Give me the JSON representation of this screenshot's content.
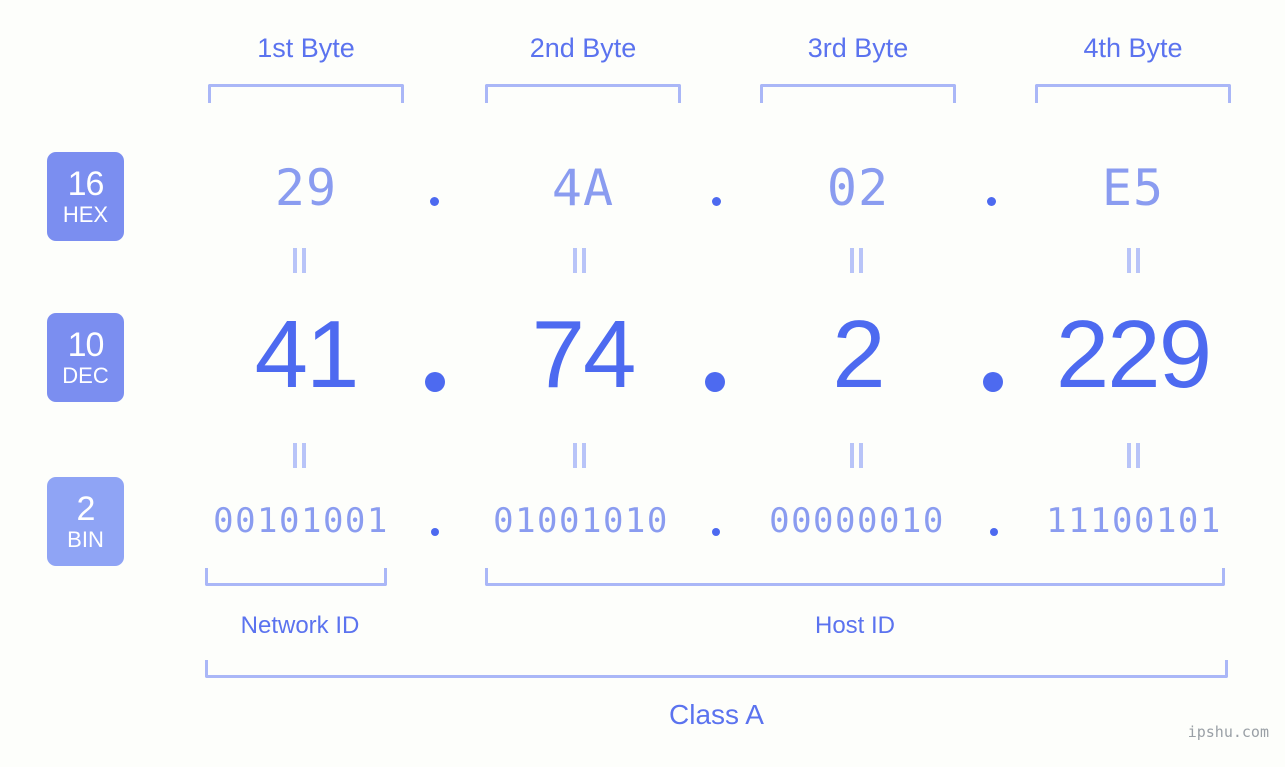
{
  "background_color": "#fdfefb",
  "colors": {
    "label_blue": "#5b73ef",
    "bracket_blue": "#aab7f7",
    "hex_value": "#8a9cf0",
    "dec_value": "#4d6af0",
    "bin_value": "#8a9cf0",
    "badge_dark": "#7b8ef0",
    "badge_light": "#8fa4f5",
    "eq_mark": "#b8c4f8",
    "watermark": "#9aa0a6"
  },
  "byte_headers": [
    {
      "label": "1st Byte"
    },
    {
      "label": "2nd Byte"
    },
    {
      "label": "3rd Byte"
    },
    {
      "label": "4th Byte"
    }
  ],
  "radix_badges": [
    {
      "number": "16",
      "abbr": "HEX",
      "color": "#7b8ef0"
    },
    {
      "number": "10",
      "abbr": "DEC",
      "color": "#7b8ef0"
    },
    {
      "number": "2",
      "abbr": "BIN",
      "color": "#8fa4f5"
    }
  ],
  "rows": {
    "hex": {
      "radix": "16",
      "name": "HEX",
      "values": [
        "29",
        "4A",
        "02",
        "E5"
      ],
      "separator": "."
    },
    "dec": {
      "radix": "10",
      "name": "DEC",
      "values": [
        "41",
        "74",
        "2",
        "229"
      ],
      "separator": "."
    },
    "bin": {
      "radix": "2",
      "name": "BIN",
      "values": [
        "00101001",
        "01001010",
        "00000010",
        "11100101"
      ],
      "separator": "."
    }
  },
  "equivalence_symbol": "=",
  "id_sections": [
    {
      "label": "Network ID"
    },
    {
      "label": "Host ID"
    }
  ],
  "class_section": {
    "label": "Class A"
  },
  "watermark": {
    "text": "ipshu.com"
  }
}
